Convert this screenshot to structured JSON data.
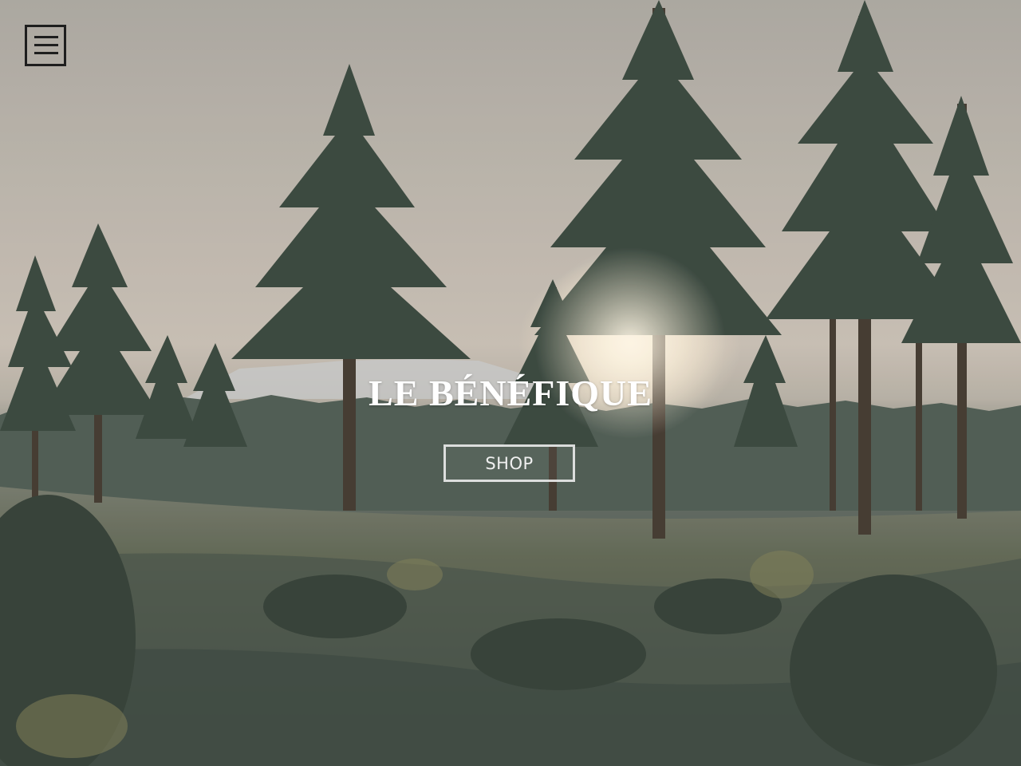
{
  "hero": {
    "title": "LE BÉNÉFIQUE",
    "shop_label": "SHOP"
  },
  "icons": {
    "menu": "hamburger-menu-icon"
  },
  "colors": {
    "menu_icon": "#1e1e1e",
    "title_text": "#ffffff",
    "button_border": "#ebebeb"
  }
}
